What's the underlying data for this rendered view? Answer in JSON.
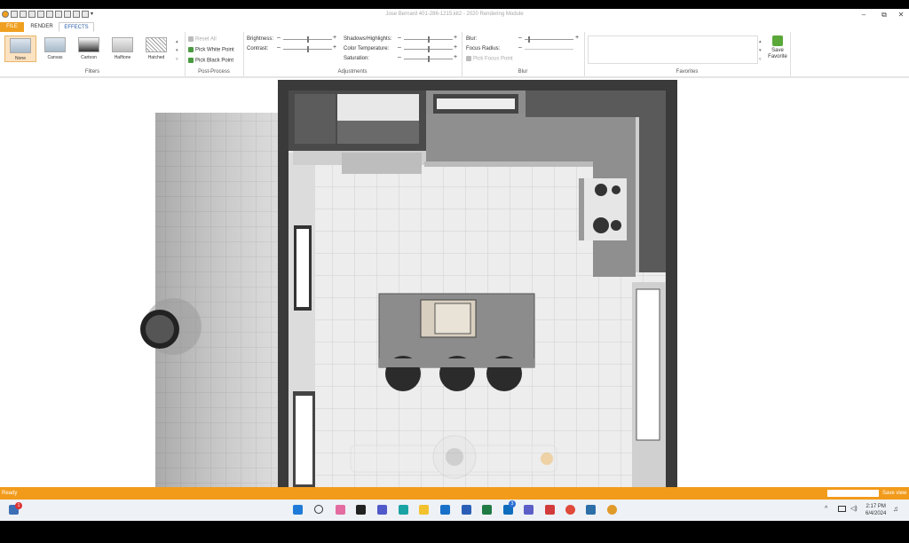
{
  "window": {
    "title": "Jose Bernard 401-286-1215.kit2 - 2020 Rendering Module"
  },
  "tabs": [
    {
      "label": "FILE"
    },
    {
      "label": "RENDER"
    },
    {
      "label": "EFFECTS"
    }
  ],
  "filters": {
    "group_label": "Filters",
    "items": [
      {
        "label": "None"
      },
      {
        "label": "Canvas"
      },
      {
        "label": "Cartoon"
      },
      {
        "label": "Halftone"
      },
      {
        "label": "Hatched"
      }
    ]
  },
  "postprocess": {
    "group_label": "Post-Process",
    "reset_all": "Reset All",
    "pick_white": "Pick White Point",
    "pick_black": "Pick Black Point"
  },
  "adjustments": {
    "group_label": "Adjustments",
    "brightness": "Brightness:",
    "contrast": "Contrast:",
    "shadows": "Shadows/Highlights:",
    "color_temp": "Color Temperature:",
    "saturation": "Saturation:"
  },
  "blur": {
    "group_label": "Blur",
    "blur": "Blur:",
    "focus_radius": "Focus Radius:",
    "pick_focus": "Pick Focus Point"
  },
  "favorites": {
    "group_label": "Favorites",
    "save_line1": "Save",
    "save_line2": "Favorite"
  },
  "status": {
    "text": "Ready",
    "save_view": "Save view"
  },
  "taskbar": {
    "time": "2:17 PM",
    "date": "6/4/2024",
    "notif_badge": "1",
    "outlook_badge": "3"
  }
}
